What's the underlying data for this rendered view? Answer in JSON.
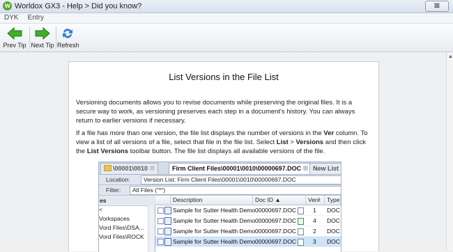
{
  "window": {
    "title": "Worldox GX3 - Help > Did you know?",
    "close_label": "⊠",
    "app_icon_letter": "w"
  },
  "menu": [
    "DYK",
    "Entry"
  ],
  "toolbar": {
    "prev_label": "Prev Tip",
    "next_label": "Next Tip",
    "refresh_label": "Refresh",
    "arrow_color": "#3fae2a",
    "refresh_color": "#2f7fd1"
  },
  "article": {
    "title": "List Versions in the File List",
    "para1": "Versioning documents allows you to revise documents while preserving the original files. It is a secure way to work, as versioning preserves each step in a document's history. You can always return to earlier versions if necessary.",
    "para2_a": "If a file has more than one version, the file list displays the number of versions in the ",
    "para2_ver": "Ver",
    "para2_b": " column. To view a list of all versions of a file, select that file in the file list. Select ",
    "para2_list": "List",
    "para2_c": " > ",
    "para2_versions": "Versions",
    "para2_d": " and then click the ",
    "para2_listversions": "List Versions",
    "para2_e": " toolbar button. The file list displays all available versions of the file."
  },
  "embedded": {
    "tab1": "\\00001\\0010",
    "tab2": "Firm Client Files\\00001\\0010\\00000697.DOC",
    "tab3": "New List",
    "location_label": "Location:",
    "location_value": "Version List: Firm Client Files\\00001\\0010\\00000697.DOC",
    "filter_label": "Filter:",
    "filter_value": "All Files (\"*\")",
    "left_header": "es",
    "left_items": [
      "<",
      "Vorkspaces",
      "Vord Files\\DSA...",
      "Vord Files\\ROCK"
    ],
    "columns": {
      "description": "Description",
      "docid": "Doc ID ▲",
      "ver": "Ver#",
      "type": "Type"
    },
    "rows": [
      {
        "description": "Sample for Sutter Health Demo",
        "docid": "00000697.DOC",
        "ver": "1",
        "type": "DOC"
      },
      {
        "description": "Sample for Sutter Health Demo",
        "docid": "00000697.DOC",
        "ver": "4",
        "type": "DOC"
      },
      {
        "description": "Sample for Sutter Health Demo",
        "docid": "00000697.DOC",
        "ver": "2",
        "type": "DOC"
      },
      {
        "description": "Sample for Sutter Health Demo",
        "docid": "00000697.DOC",
        "ver": "3",
        "type": "DOC"
      }
    ]
  }
}
